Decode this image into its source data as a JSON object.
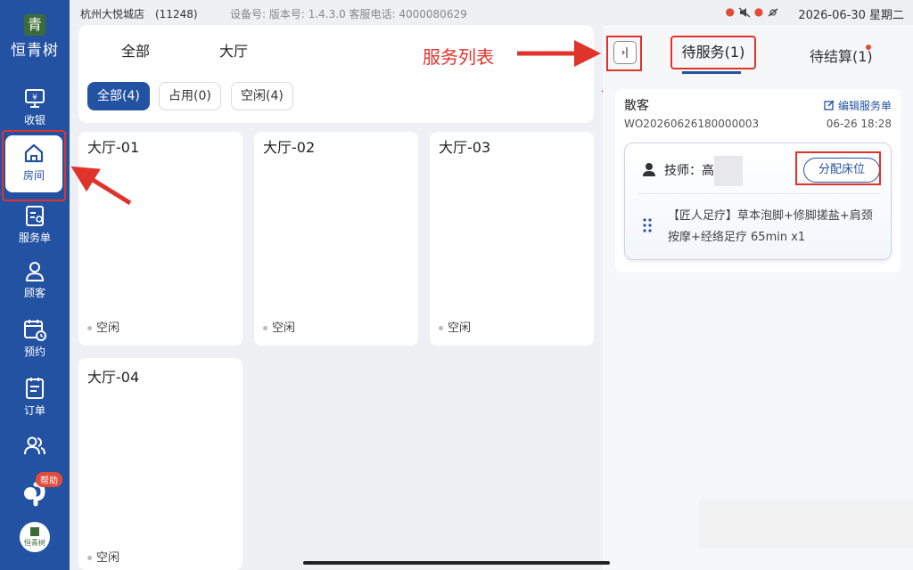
{
  "app": {
    "logo_mark": "青",
    "logo_name": "恒青树",
    "mini_logo_text": "恒青树"
  },
  "status_bar": {
    "store": "杭州大悦城店　(11248)",
    "device": "设备号:  版本号:  1.4.3.0  客服电话:  4000080629",
    "datetime": "2026-06-30 星期二"
  },
  "sidebar": {
    "items": [
      {
        "label": "收银",
        "icon": "cashier-icon"
      },
      {
        "label": "房间",
        "icon": "home-icon"
      },
      {
        "label": "服务单",
        "icon": "service-order-icon"
      },
      {
        "label": "顾客",
        "icon": "customer-icon"
      },
      {
        "label": "预约",
        "icon": "calendar-icon"
      },
      {
        "label": "订单",
        "icon": "order-icon"
      },
      {
        "label": "",
        "icon": "users-icon"
      }
    ],
    "active": "房间",
    "help_badge": "帮助"
  },
  "filter": {
    "areas": [
      "全部",
      "大厅"
    ],
    "chips": [
      {
        "label": "全部(4)",
        "active": true
      },
      {
        "label": "占用(0)",
        "active": false
      },
      {
        "label": "空闲(4)",
        "active": false
      }
    ]
  },
  "rooms": [
    {
      "name": "大厅-01",
      "status": "空闲"
    },
    {
      "name": "大厅-02",
      "status": "空闲"
    },
    {
      "name": "大厅-03",
      "status": "空闲"
    },
    {
      "name": "大厅-04",
      "status": "空闲"
    }
  ],
  "annotation": "服务列表",
  "service_panel": {
    "tabs": [
      {
        "label": "待服务(1)",
        "active": true
      },
      {
        "label": "待结算(1)",
        "active": false
      }
    ],
    "order": {
      "customer": "散客",
      "edit_label": "编辑服务单",
      "order_no": "WO20260626180000003",
      "time": "06-26 18:28",
      "technician_label": "技师：高",
      "assign_label": "分配床位",
      "service": "【匠人足疗】草本泡脚+修脚搓盐+肩颈按摩+经络足疗 65min x1"
    }
  },
  "colors": {
    "primary": "#2452a3",
    "annotation": "#e0332b",
    "badge": "#e24c3d"
  }
}
